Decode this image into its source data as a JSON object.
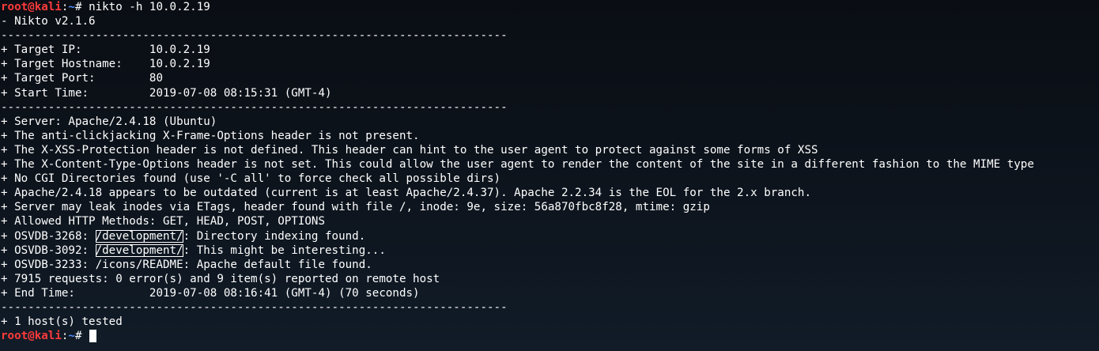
{
  "prompt": {
    "user_host": "root@kali",
    "sep": ":",
    "dir": "~",
    "symbol": "# "
  },
  "command": "nikto -h 10.0.2.19",
  "lines": {
    "version": "- Nikto v2.1.6",
    "divider": "---------------------------------------------------------------------------",
    "target_ip": "+ Target IP:          10.0.2.19",
    "target_hostname": "+ Target Hostname:    10.0.2.19",
    "target_port": "+ Target Port:        80",
    "start_time": "+ Start Time:         2019-07-08 08:15:31 (GMT-4)",
    "server": "+ Server: Apache/2.4.18 (Ubuntu)",
    "clickjacking": "+ The anti-clickjacking X-Frame-Options header is not present.",
    "xss": "+ The X-XSS-Protection header is not defined. This header can hint to the user agent to protect against some forms of XSS",
    "content_type": "+ The X-Content-Type-Options header is not set. This could allow the user agent to render the content of the site in a different fashion to the MIME type",
    "cgi": "+ No CGI Directories found (use '-C all' to force check all possible dirs)",
    "outdated": "+ Apache/2.4.18 appears to be outdated (current is at least Apache/2.4.37). Apache 2.2.34 is the EOL for the 2.x branch.",
    "inodes": "+ Server may leak inodes via ETags, header found with file /, inode: 9e, size: 56a870fbc8f28, mtime: gzip",
    "methods": "+ Allowed HTTP Methods: GET, HEAD, POST, OPTIONS",
    "osvdb_3268_prefix": "+ OSVDB-3268: ",
    "osvdb_3268_path": "/development/",
    "osvdb_3268_suffix": ": Directory indexing found.",
    "osvdb_3092_prefix": "+ OSVDB-3092: ",
    "osvdb_3092_path": "/development/",
    "osvdb_3092_suffix": ": This might be interesting...",
    "osvdb_3233": "+ OSVDB-3233: /icons/README: Apache default file found.",
    "requests": "+ 7915 requests: 0 error(s) and 9 item(s) reported on remote host",
    "end_time": "+ End Time:           2019-07-08 08:16:41 (GMT-4) (70 seconds)",
    "hosts_tested": "+ 1 host(s) tested"
  },
  "colors": {
    "background": "#0d141d",
    "text": "#ffffff",
    "prompt_user": "#ff3b3b",
    "prompt_dir": "#4f8dff"
  }
}
